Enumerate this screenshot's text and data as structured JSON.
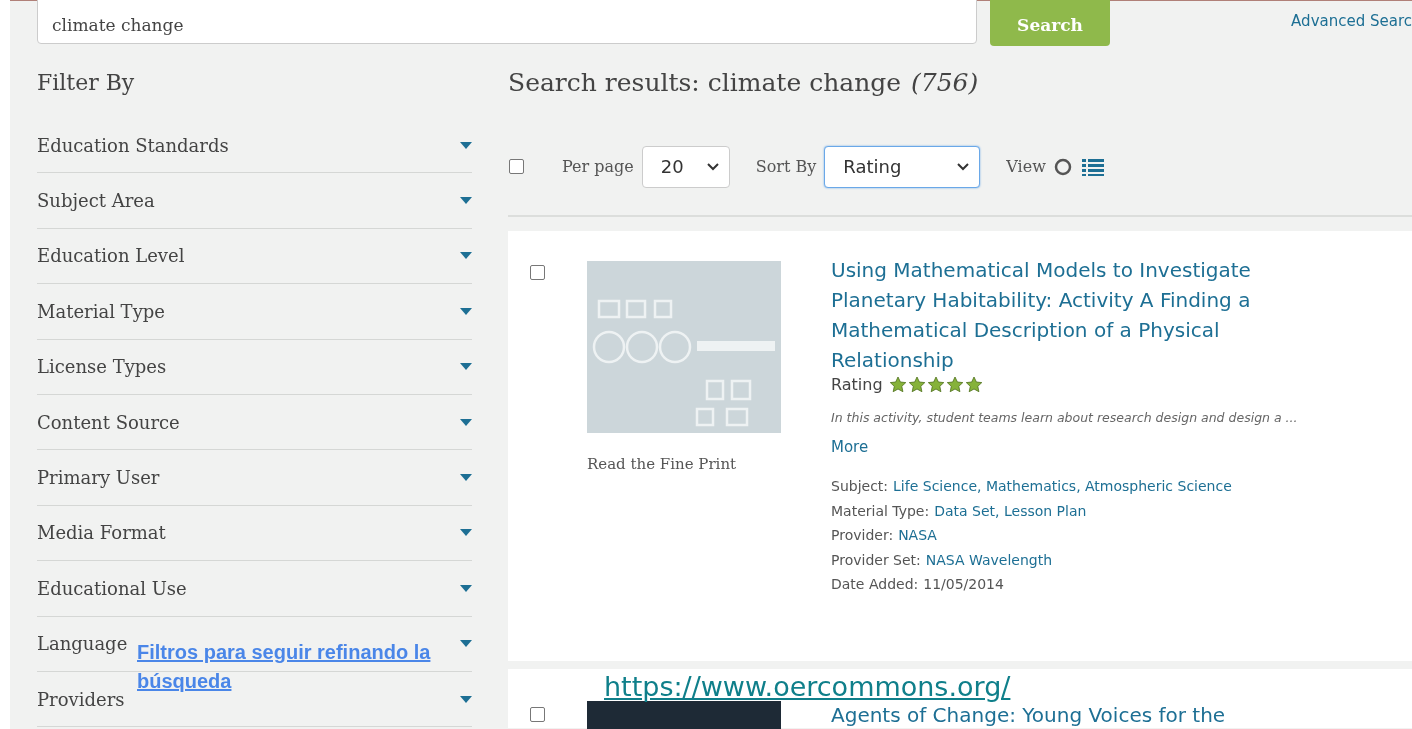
{
  "search": {
    "value": "climate change",
    "button": "Search",
    "advanced_link": "Advanced Searc"
  },
  "filters": {
    "title": "Filter By",
    "items": [
      {
        "label": "Education Standards",
        "expanded": false
      },
      {
        "label": "Subject Area",
        "expanded": false
      },
      {
        "label": "Education Level",
        "expanded": false
      },
      {
        "label": "Material Type",
        "expanded": false
      },
      {
        "label": "License Types",
        "expanded": false
      },
      {
        "label": "Content Source",
        "expanded": false
      },
      {
        "label": "Primary User",
        "expanded": false
      },
      {
        "label": "Media Format",
        "expanded": false
      },
      {
        "label": "Educational Use",
        "expanded": false
      },
      {
        "label": "Language",
        "expanded": false
      },
      {
        "label": "Providers",
        "expanded": false
      }
    ]
  },
  "results": {
    "heading": "Search results: climate change *(756)*",
    "toolbar": {
      "select_all_checked": false,
      "per_page_label": "Per page",
      "per_page": "20",
      "sort_label": "Sort By",
      "sort": "Rating",
      "view_label": "View"
    },
    "items": [
      {
        "checked": false,
        "fine_print": "Read the Fine Print",
        "title": "Using Mathematical Models to Investigate Planetary Habitability: Activity A Finding a Mathematical Description of a Physical Relationship",
        "rating_label": "Rating",
        "stars": 5,
        "description": "In this activity, student teams learn about research design and design a ...",
        "more": "More",
        "meta": [
          {
            "label": "Subject:",
            "value": "Life Science, Mathematics, Atmospheric Science",
            "linked": true
          },
          {
            "label": "Material Type:",
            "value": "Data Set, Lesson Plan",
            "linked": true
          },
          {
            "label": "Provider:",
            "value": "NASA",
            "linked": true
          },
          {
            "label": "Provider Set:",
            "value": "NASA Wavelength",
            "linked": true
          },
          {
            "label": "Date Added:",
            "value": "11/05/2014",
            "linked": false
          }
        ]
      },
      {
        "checked": false,
        "title": "Agents of Change: Young Voices for the"
      }
    ]
  },
  "annotations": [
    {
      "kind": "caption",
      "text": "Filtros para seguir refinando la búsqueda"
    },
    {
      "kind": "url",
      "text": "https://www.oercommons.org/"
    }
  ]
}
